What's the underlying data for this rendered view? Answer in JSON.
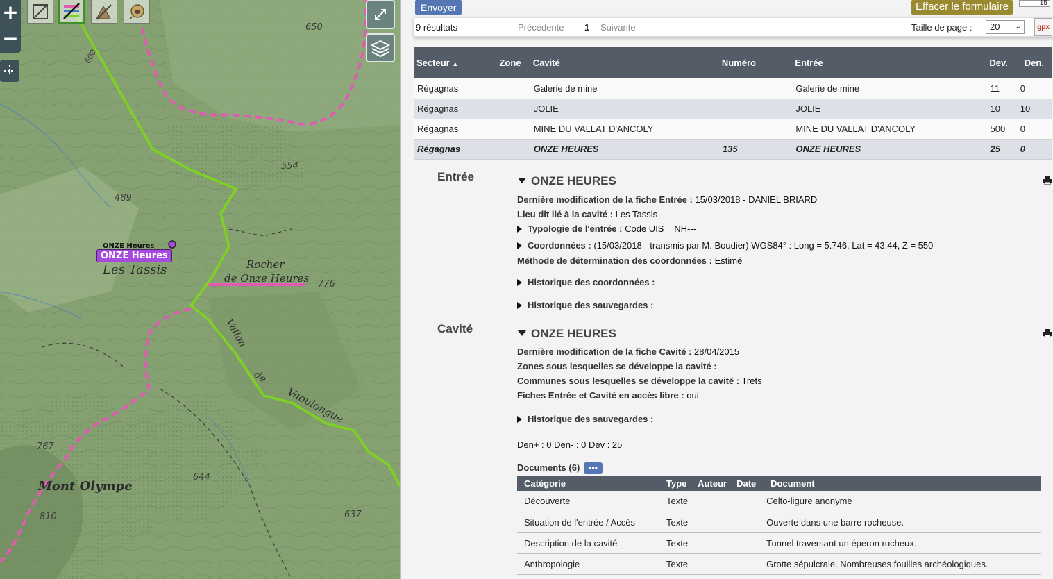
{
  "map": {
    "zoom_in": "+",
    "zoom_out": "−",
    "marker_label": "ONZE Heures",
    "marker_sublabel": "ONZE Heures",
    "place_labels": [
      "Les Tassis",
      "Rocher",
      "de Onze Heures",
      "Mont Olympe",
      "Vallon",
      "de",
      "Vaoulongue"
    ],
    "altitudes": [
      "650",
      "554",
      "489",
      "776",
      "767",
      "644",
      "810",
      "637",
      "600"
    ],
    "colors": {
      "trail_green": "#7ed321",
      "boundary_pink": "#e05cb0",
      "marker": "#a64be0"
    }
  },
  "panel": {
    "envoyer": "Envoyer",
    "effacer": "Effacer le formulaire",
    "top_right_num": "15",
    "results_count": "9 résultats",
    "prev": "Précédente",
    "page_num": "1",
    "next": "Suivante",
    "page_size_label": "Taille de page :",
    "page_size_value": "20",
    "gpx": "gpx"
  },
  "results_table": {
    "headers": [
      "Secteur",
      "Zone",
      "Cavité",
      "Numéro",
      "Entrée",
      "Dev.",
      "Den."
    ],
    "rows": [
      [
        "Régagnas",
        "",
        "Galerie de mine",
        "",
        "Galerie de mine",
        "11",
        "0"
      ],
      [
        "Régagnas",
        "",
        "JOLIE",
        "",
        "JOLIE",
        "10",
        "10"
      ],
      [
        "Régagnas",
        "",
        "MINE DU VALLAT D'ANCOLY",
        "",
        "MINE DU VALLAT D'ANCOLY",
        "500",
        "0"
      ],
      [
        "Régagnas",
        "",
        "ONZE HEURES",
        "135",
        "ONZE HEURES",
        "25",
        "0"
      ]
    ]
  },
  "entree": {
    "section": "Entrée",
    "title": "ONZE HEURES",
    "l1_label": "Dernière modification de la fiche Entrée :",
    "l1_value": "15/03/2018 - DANIEL BRIARD",
    "l2_label": "Lieu dit lié à la cavité :",
    "l2_value": "Les Tassis",
    "l3_label": "Typologie de l'entrée :",
    "l3_value": "Code UIS = NH---",
    "l4_label": "Coordonnées :",
    "l4_value": "(15/03/2018 - transmis par M. Boudier) WGS84° : Long = 5.746, Lat = 43.44, Z = 550",
    "l5_label": "Méthode de détermination des coordonnées :",
    "l5_value": "Estimé",
    "l6_label": "Historique des coordonnées :",
    "l7_label": "Historique des sauvegardes :"
  },
  "cavite": {
    "section": "Cavité",
    "title": "ONZE HEURES",
    "l1_label": "Dernière modification de la fiche Cavité :",
    "l1_value": "28/04/2015",
    "l2_label": "Zones sous lesquelles se développe la cavité :",
    "l3_label": "Communes sous lesquelles se développe la cavité :",
    "l3_value": "Trets",
    "l4_label": "Fiches Entrée et Cavité en accès libre :",
    "l4_value": "oui",
    "l5_label": "Historique des sauvegardes :",
    "l6_value": "Den+ : 0 Den- : 0 Dev : 25",
    "docs_label": "Documents (6)",
    "docs_btn": "•••"
  },
  "docs_table": {
    "headers": [
      "Catégorie",
      "Type",
      "Auteur",
      "Date",
      "Document"
    ],
    "rows": [
      [
        "Découverte",
        "Texte",
        "",
        "",
        "Celto-ligure anonyme"
      ],
      [
        "Situation de l'entrée / Accès",
        "Texte",
        "",
        "",
        "Ouverte dans une barre rocheuse."
      ],
      [
        "Description de la cavité",
        "Texte",
        "",
        "",
        "Tunnel traversant un éperon rocheux."
      ],
      [
        "Anthropologie",
        "Texte",
        "",
        "",
        "Grotte sépulcrale. Nombreuses fouilles archéologiques."
      ]
    ]
  }
}
